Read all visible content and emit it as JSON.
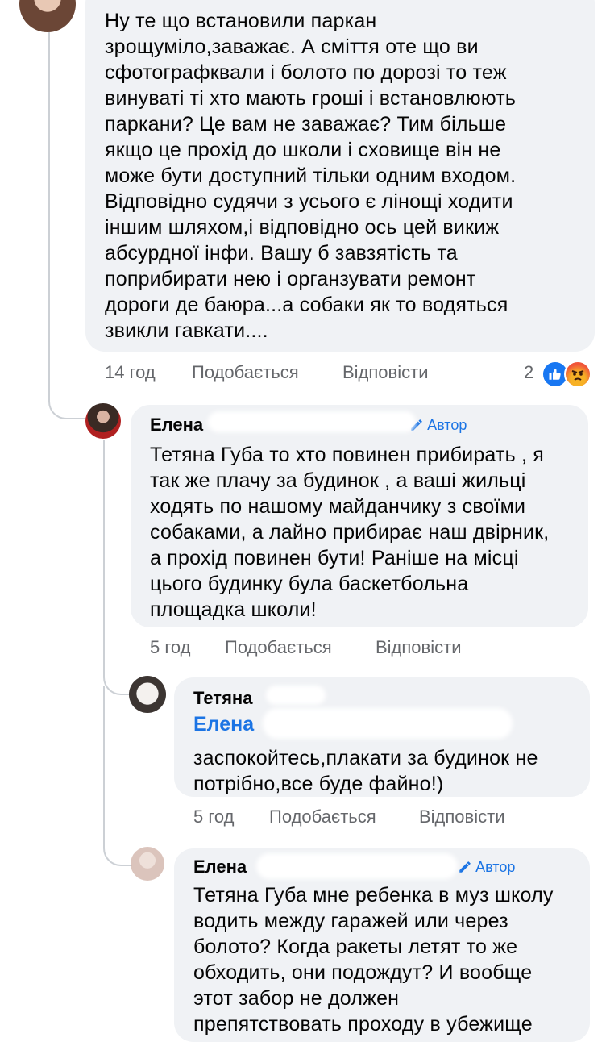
{
  "comments": [
    {
      "text": "Ну те що встановили паркан\nзрощуміло,заважає. А сміття оте що ви\nсфотографквали і болото по дорозі то теж\nвинуваті ті хто мають гроші і встановлюють\nпаркани? Це вам не заважає? Тим більше\nякщо це прохід до школи і сховище він не\nможе бути доступний тільки одним входом.\nВідповідно судячи з усього є лінощі ходити\nіншим шляхом,і відповідно ось цей викиж\nабсурдної інфи. Вашу б завзятість та\nпоприбирати нею і органзувати ремонт\nдороги де баюра...а собаки як то водяться\nзвикли гавкати....",
      "time": "14 год",
      "like_label": "Подобається",
      "reply_label": "Відповісти",
      "reactions_count": "2",
      "reactions": [
        "like",
        "angry"
      ]
    },
    {
      "author_visible": "Елена",
      "author_badge": "Автор",
      "text": "Тетяна Губа то хто повинен прибирать , я\nтак же плачу за будинок , а ваші жильці\nходять по нашому майданчику з своїми\nсобаками, а лайно прибирає наш двірник,\nа прохід повинен бути! Раніше на місці\nцього будинку була баскетбольна\nплощадка школи!",
      "time": "5 год",
      "like_label": "Подобається",
      "reply_label": "Відповісти"
    },
    {
      "author_visible": "Тетяна",
      "mention_visible": "Елена",
      "text": "заспокойтесь,плакати за будинок не\nпотрібно,все буде файно!)",
      "time": "5 год",
      "like_label": "Подобається",
      "reply_label": "Відповісти"
    },
    {
      "author_visible": "Елена",
      "author_badge": "Автор",
      "text": "Тетяна Губа мне ребенка в муз школу\nводить между гаражей или через\nболото? Когда ракеты летят то же\nобходить, они подождут? И вообще\nэтот забор не должен\nпрепятствовать проходу в убежище"
    }
  ],
  "colors": {
    "bubble": "#f0f2f5",
    "meta": "#65676b",
    "link": "#1b74e4",
    "like": "#1877f2",
    "angry": "#f0563a"
  }
}
